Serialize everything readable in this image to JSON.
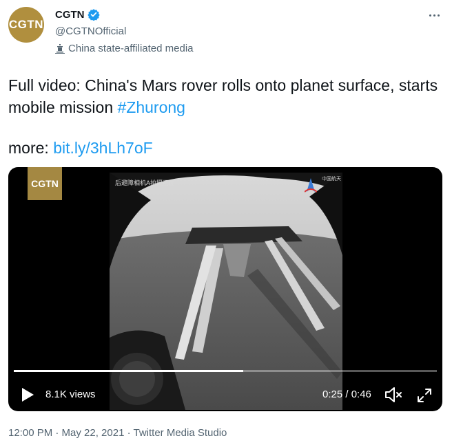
{
  "account": {
    "avatar_text": "CGTN",
    "name": "CGTN",
    "handle": "@CGTNOfficial",
    "affiliation": "China state-affiliated media"
  },
  "tweet": {
    "text_main": "Full video: China's Mars rover rolls onto planet surface, starts mobile mission ",
    "hashtag": "#Zhurong",
    "more_prefix": "more: ",
    "link": "bit.ly/3hLh7oF"
  },
  "video": {
    "badge": "CGTN",
    "camera_label": "后避障相机A拍摄画面",
    "logo_text": "中国航天",
    "progress_fraction": 0.543,
    "views": "8.1K views",
    "time": "0:25 / 0:46"
  },
  "meta": {
    "timestamp": "12:00 PM · May 22, 2021 · Twitter Media Studio"
  },
  "colors": {
    "link": "#1d9bf0",
    "verified": "#1d9bf0",
    "secondary_text": "#536471",
    "avatar": "#b08f3e"
  },
  "icons": [
    "verified-badge-icon",
    "state-media-icon",
    "more-options-icon",
    "play-icon",
    "volume-icon",
    "fullscreen-icon"
  ]
}
